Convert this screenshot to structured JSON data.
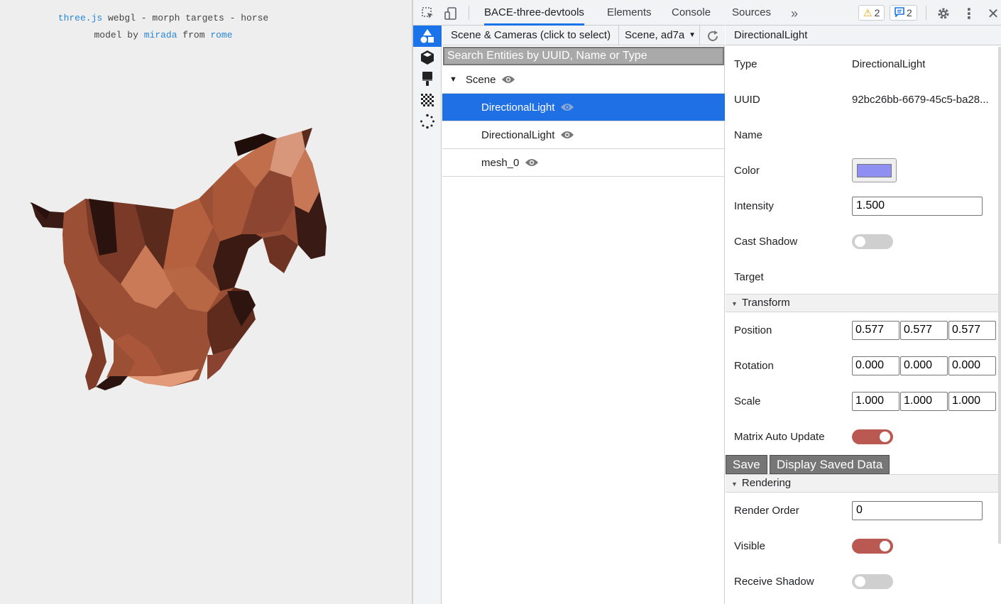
{
  "viewport": {
    "info_link": "three.js",
    "info_text": " webgl - morph targets - horse",
    "credit_prefix": "model by ",
    "credit_author": "mirada",
    "credit_mid": " from ",
    "credit_place": "rome",
    "background": "#eeeeee",
    "link_color": "#2887d8"
  },
  "devtools": {
    "toolbar": {
      "inspect_icon": "cursor-select-icon",
      "device_icon": "device-toggle-icon",
      "tabs": [
        "BACE-three-devtools",
        "Elements",
        "Console",
        "Sources"
      ],
      "active_tab": "BACE-three-devtools",
      "more_tabs_icon": "chevron-double-right-icon",
      "warnings_count": "2",
      "messages_count": "2",
      "settings_icon": "gear-icon",
      "menu_icon": "vertical-dots-icon",
      "close_icon": "close-icon",
      "accent": "#1a73e8"
    },
    "rail": {
      "items": [
        "shapes-icon",
        "cube-icon",
        "paint-brush-icon",
        "checkerboard-icon",
        "loading-dots-icon"
      ],
      "active": "shapes-icon"
    },
    "tree": {
      "header_label": "Scene & Cameras (click to select)",
      "scene_select_value": "Scene, ad7a",
      "search_placeholder": "Search Entities by UUID, Name or Type",
      "root": "Scene",
      "children": [
        "DirectionalLight",
        "DirectionalLight",
        "mesh_0"
      ],
      "selected": "DirectionalLight",
      "selected_color": "#1f6fe5"
    },
    "inspector": {
      "title": "DirectionalLight",
      "type_label": "Type",
      "type_value": "DirectionalLight",
      "uuid_label": "UUID",
      "uuid_value": "92bc26bb-6679-45c5-ba28...",
      "name_label": "Name",
      "color_label": "Color",
      "color_value": "#8f8ff2",
      "intensity_label": "Intensity",
      "intensity_value": "1.500",
      "cast_shadow_label": "Cast Shadow",
      "cast_shadow": false,
      "target_label": "Target",
      "transform_section": "Transform",
      "position_label": "Position",
      "position": [
        "0.577",
        "0.577",
        "0.577"
      ],
      "rotation_label": "Rotation",
      "rotation": [
        "0.000",
        "0.000",
        "0.000"
      ],
      "scale_label": "Scale",
      "scale": [
        "1.000",
        "1.000",
        "1.000"
      ],
      "matrix_auto_update_label": "Matrix Auto Update",
      "matrix_auto_update": true,
      "save_label": "Save",
      "display_saved_label": "Display Saved Data",
      "rendering_section": "Rendering",
      "render_order_label": "Render Order",
      "render_order_value": "0",
      "visible_label": "Visible",
      "visible": true,
      "receive_shadow_label": "Receive Shadow",
      "receive_shadow": false,
      "toggle_on_color": "#b95951"
    }
  }
}
